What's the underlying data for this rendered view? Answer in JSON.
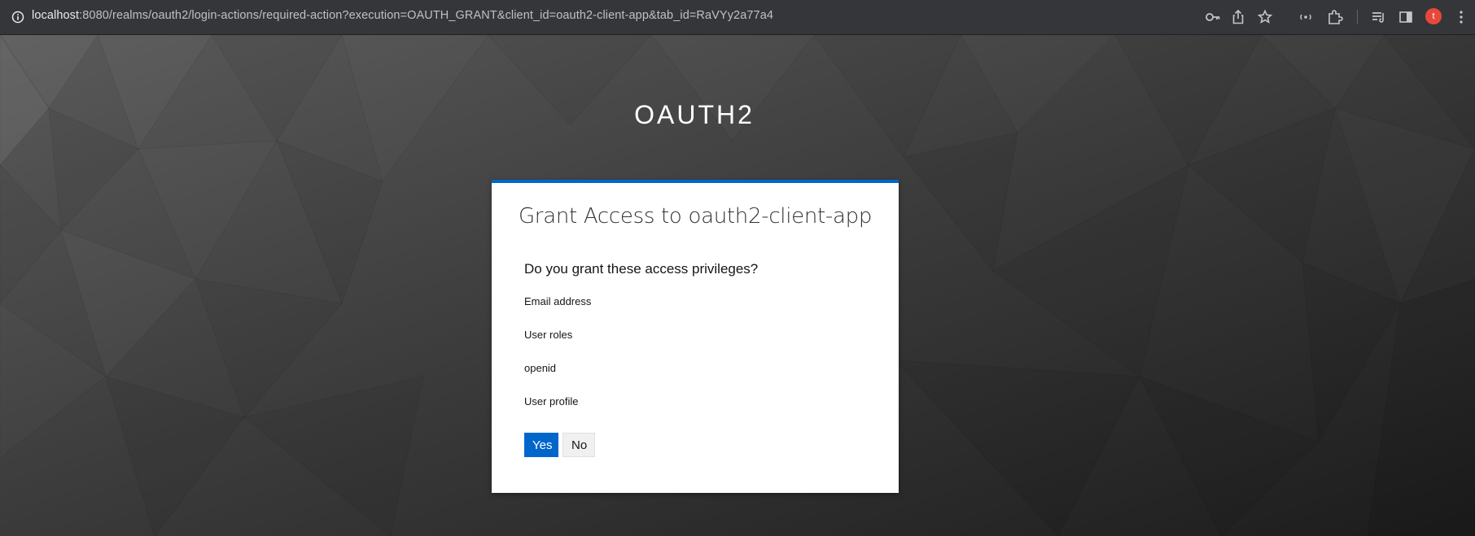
{
  "browser": {
    "url_host": "localhost",
    "url_rest": ":8080/realms/oauth2/login-actions/required-action?execution=OAUTH_GRANT&client_id=oauth2-client-app&tab_id=RaVYy2a77a4",
    "avatar_initial": "t",
    "icons": [
      "info-icon",
      "key-icon",
      "share-icon",
      "star-icon",
      "extension-cast-icon",
      "puzzle-icon",
      "media-queue-icon",
      "side-panel-icon",
      "avatar",
      "kebab-menu-icon"
    ]
  },
  "realm": {
    "title": "OAUTH2"
  },
  "consent": {
    "title": "Grant Access to oauth2-client-app",
    "question": "Do you grant these access privileges?",
    "scopes": [
      "Email address",
      "User roles",
      "openid",
      "User profile"
    ],
    "yes_label": "Yes",
    "no_label": "No"
  },
  "colors": {
    "accent": "#0066cc",
    "address_bar": "#35363a",
    "avatar": "#e8483a"
  }
}
